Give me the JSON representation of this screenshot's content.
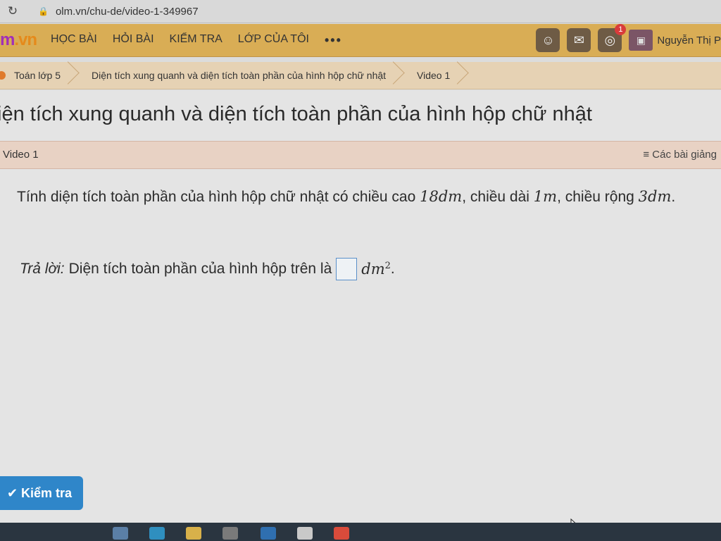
{
  "browser": {
    "url": "olm.vn/chu-de/video-1-349967",
    "reload_icon": "reload-icon",
    "lock_icon": "lock-icon"
  },
  "nav": {
    "logo_prefix": "m",
    "logo_suffix": ".vn",
    "items": [
      "HỌC BÀI",
      "HỎI BÀI",
      "KIỂM TRA",
      "LỚP CỦA TÔI"
    ],
    "more": "•••",
    "notification_count": "1",
    "username": "Nguyễn Thị P"
  },
  "breadcrumb": {
    "items": [
      "Toán lớp 5",
      "Diện tích xung quanh và diện tích toàn phần của hình hộp chữ nhật",
      "Video 1"
    ]
  },
  "page": {
    "title": "iện tích xung quanh và diện tích toàn phần của hình hộp chữ nhật",
    "video_label": "Video 1",
    "lessons_link": "≡ Các bài giảng"
  },
  "question": {
    "text_1": "Tính diện tích toàn phần của hình hộp chữ nhật có chiều cao ",
    "m1": "18dm",
    "text_2": ", chiều dài ",
    "m2": "1m",
    "text_3": ", chiều rộng ",
    "m3": "3dm",
    "text_4": "."
  },
  "answer": {
    "prefix": "Trả lời:",
    "text": "Diện tích toàn phần của hình hộp trên là",
    "unit": "dm",
    "unit_power": "2",
    "end": "."
  },
  "check_button": {
    "label": "✔ Kiểm tra"
  },
  "colors": {
    "nav_bg": "#d9ad55",
    "breadcrumb_bg": "#e6d2b4",
    "video_bar_bg": "#e8d2c4",
    "button_bg": "#2f86c9"
  }
}
